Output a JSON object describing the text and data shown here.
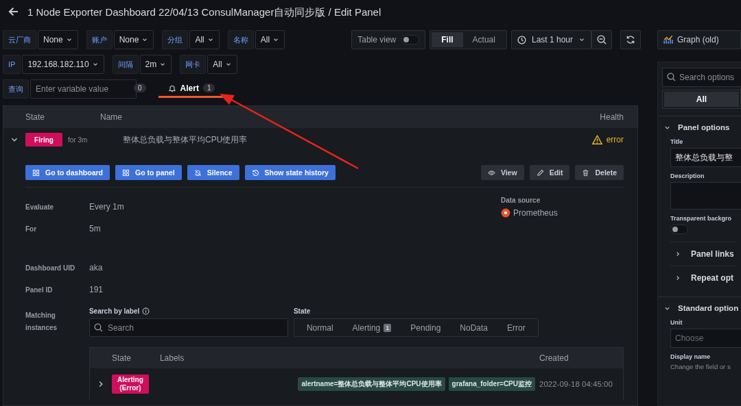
{
  "header": {
    "title": "1 Node Exporter Dashboard 22/04/13 ConsulManager自动同步版 / Edit Panel"
  },
  "variable_rows": [
    {
      "items": [
        {
          "kind": "select",
          "label": "云厂商",
          "value": "None"
        },
        {
          "kind": "select",
          "label": "账户",
          "value": "None"
        },
        {
          "kind": "select",
          "label": "分组",
          "value": "All"
        },
        {
          "kind": "select",
          "label": "名称",
          "value": "All"
        }
      ]
    },
    {
      "items": [
        {
          "kind": "select",
          "label": "IP",
          "value": "192.168.182.110"
        },
        {
          "kind": "select",
          "label": "间隔",
          "value": "2m"
        },
        {
          "kind": "select",
          "label": "网卡",
          "value": "All"
        }
      ]
    },
    {
      "items": [
        {
          "kind": "text",
          "label": "查询",
          "placeholder": "Enter variable value"
        }
      ]
    }
  ],
  "panel_toolbar": {
    "table_view": {
      "label": "Table view",
      "on": false
    },
    "size_modes": [
      {
        "label": "Fill",
        "selected": true
      },
      {
        "label": "Actual",
        "selected": false
      }
    ],
    "time_range": "Last 1 hour"
  },
  "visualization": {
    "name": "Graph (old)"
  },
  "editor_tabs": [
    {
      "count": "0",
      "selected": false
    },
    {
      "label": "Alert",
      "count": "1",
      "selected": true
    }
  ],
  "alert_rules": {
    "columns": [
      "State",
      "Name",
      "Health"
    ],
    "rule": {
      "expanded": true,
      "state": "Firing",
      "duration": "for 3m",
      "name": "整体总负载与整体平均CPU使用率",
      "health": "error",
      "actions": [
        {
          "label": "Go to dashboard",
          "kind": "primary"
        },
        {
          "label": "Go to panel",
          "kind": "primary"
        },
        {
          "label": "Silence",
          "kind": "primary"
        },
        {
          "label": "Show state history",
          "kind": "primary"
        },
        {
          "label": "View",
          "kind": "secondary"
        },
        {
          "label": "Edit",
          "kind": "secondary"
        },
        {
          "label": "Delete",
          "kind": "secondary"
        }
      ],
      "details": [
        {
          "label": "Evaluate",
          "value": "Every 1m"
        },
        {
          "label": "For",
          "value": "5m"
        },
        {
          "label": "Dashboard UID",
          "value": "aka"
        },
        {
          "label": "Panel ID",
          "value": "191"
        }
      ],
      "data_source": {
        "label": "Data source",
        "value": "Prometheus"
      },
      "instances": {
        "label": "Matching instances",
        "search_label": "Search by label",
        "search_placeholder": "Search",
        "state_label": "State",
        "state_filters": [
          {
            "label": "Normal",
            "selected": false
          },
          {
            "label": "Alerting",
            "count": "1",
            "selected": false
          },
          {
            "label": "Pending",
            "selected": false
          },
          {
            "label": "NoData",
            "selected": false
          },
          {
            "label": "Error",
            "selected": false
          }
        ],
        "columns": [
          "State",
          "Labels",
          "Created"
        ],
        "rows": [
          {
            "expanded": false,
            "state": "Alerting (Error)",
            "labels": [
              "alertname=整体总负载与整体平均CPU使用率",
              "grafana_folder=CPU监控"
            ],
            "created": "2022-09-18 04:45:00"
          }
        ]
      }
    }
  },
  "options_pane": {
    "search_placeholder": "Search options",
    "tabs": [
      {
        "label": "All",
        "selected": true
      }
    ],
    "sections": [
      {
        "title": "Panel options",
        "expanded": true,
        "fields": [
          {
            "kind": "text",
            "label": "Title",
            "value": "整体总负载与整"
          },
          {
            "kind": "textarea",
            "label": "Description"
          },
          {
            "kind": "switch",
            "label": "Transparent backgro",
            "on": false
          }
        ],
        "subsections": [
          {
            "title": "Panel links",
            "expanded": false
          },
          {
            "title": "Repeat opt",
            "expanded": false
          }
        ]
      },
      {
        "title": "Standard option",
        "expanded": true,
        "fields": [
          {
            "kind": "select",
            "label": "Unit",
            "placeholder": "Choose"
          },
          {
            "kind": "note",
            "label": "Display name",
            "description": "Change the field or s"
          }
        ]
      }
    ]
  },
  "annotation": {
    "kind": "arrow"
  }
}
